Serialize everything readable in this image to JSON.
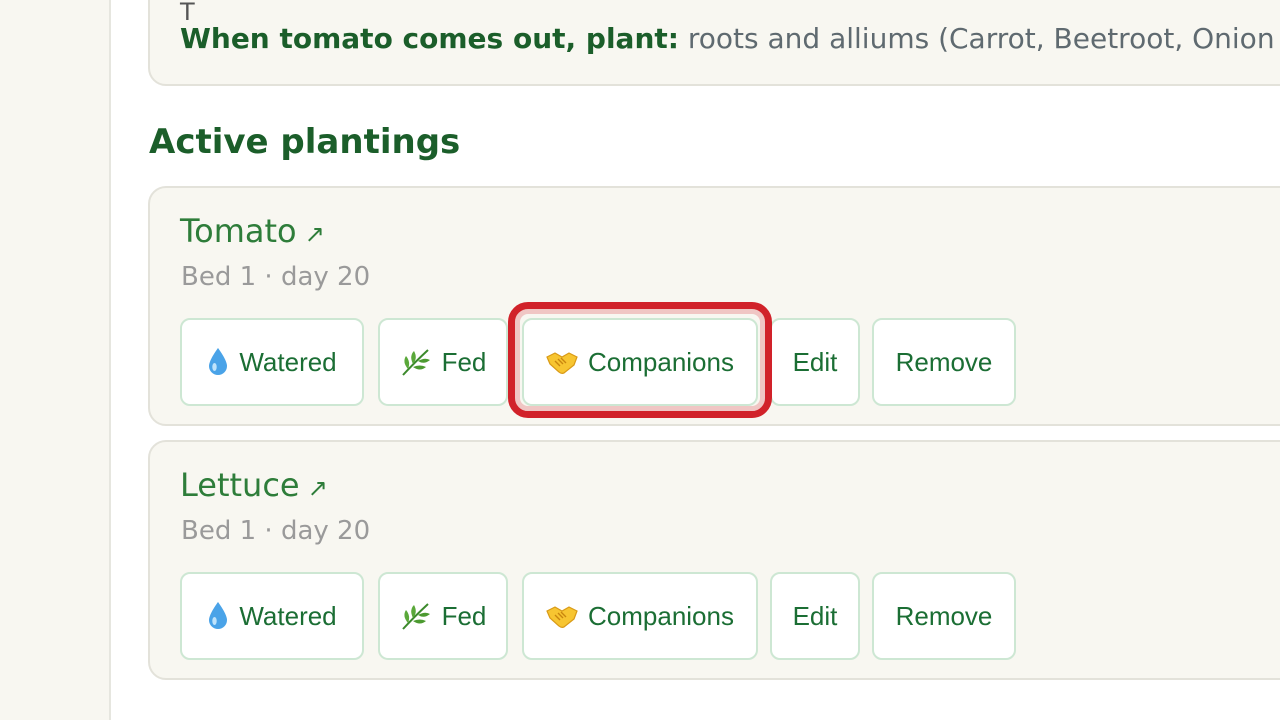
{
  "info": {
    "partial_text": "T",
    "label": "When tomato comes out, plant:",
    "text": "roots and alliums (Carrot, Beetroot, Onion"
  },
  "section": {
    "title": "Active plantings"
  },
  "plantings": [
    {
      "name": "Tomato",
      "link_icon": "↗",
      "meta": "Bed 1 · day 20",
      "buttons": {
        "watered": "Watered",
        "fed": "Fed",
        "companions": "Companions",
        "edit": "Edit",
        "remove": "Remove"
      },
      "highlighted": "companions"
    },
    {
      "name": "Lettuce",
      "link_icon": "↗",
      "meta": "Bed 1 · day 20",
      "buttons": {
        "watered": "Watered",
        "fed": "Fed",
        "companions": "Companions",
        "edit": "Edit",
        "remove": "Remove"
      }
    }
  ],
  "icons": {
    "watered": "water-drop-icon",
    "fed": "leaf-icon",
    "companions": "handshake-icon"
  },
  "colors": {
    "accent_green": "#2e7d3a",
    "dark_green": "#1b5e2a",
    "highlight_red": "#d1222a"
  }
}
